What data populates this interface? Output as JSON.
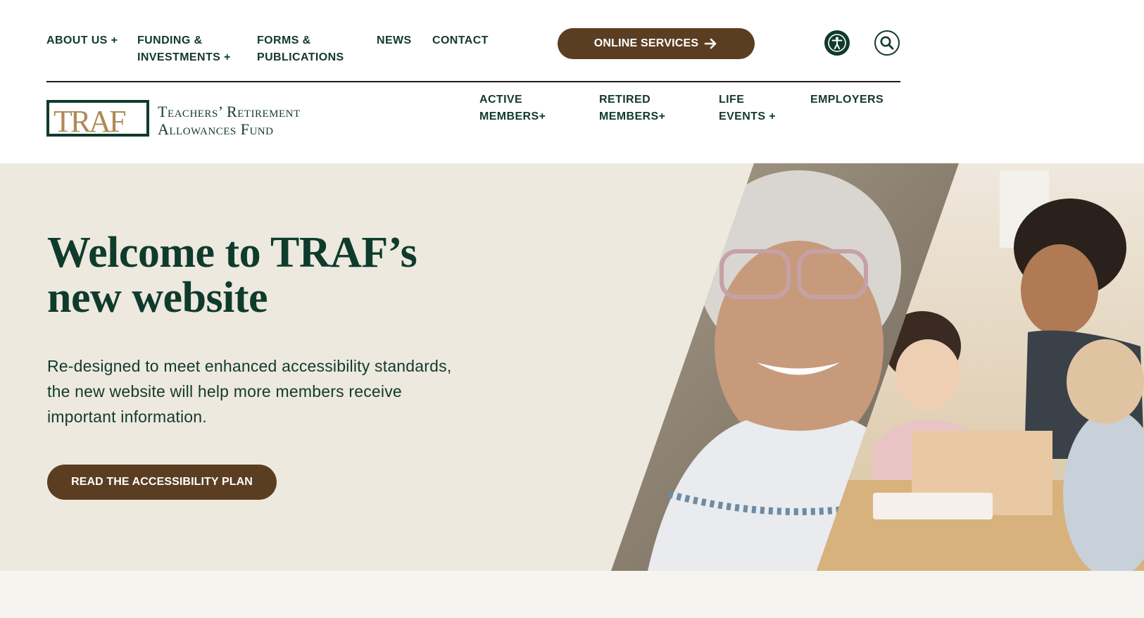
{
  "utility_nav": {
    "items": [
      {
        "line1": "ABOUT US +",
        "line2": ""
      },
      {
        "line1": "FUNDING &",
        "line2": "INVESTMENTS +"
      },
      {
        "line1": "FORMS &",
        "line2": "PUBLICATIONS"
      },
      {
        "line1": "NEWS",
        "line2": ""
      },
      {
        "line1": "CONTACT",
        "line2": ""
      }
    ],
    "online_services_label": "ONLINE SERVICES",
    "accessibility_icon": "accessibility-icon",
    "search_icon": "search-icon"
  },
  "logo": {
    "letters": "TRAF",
    "name_line1": "Teachers’ Retirement",
    "name_line2": "Allowances Fund"
  },
  "main_nav": {
    "items": [
      {
        "line1": "ACTIVE",
        "line2": "MEMBERS+"
      },
      {
        "line1": "RETIRED",
        "line2": "MEMBERS+"
      },
      {
        "line1": "LIFE",
        "line2": "EVENTS +"
      },
      {
        "line1": "EMPLOYERS",
        "line2": ""
      }
    ]
  },
  "hero": {
    "title": "Welcome to TRAF’s new website",
    "text": "Re-designed to meet enhanced accessibility standards, the new website will help more members receive important information.",
    "button_label": "READ THE ACCESSIBILITY PLAN"
  },
  "colors": {
    "brand_green": "#0f3b2c",
    "brand_brown": "#5b3e22",
    "logo_gold": "#b08a55",
    "hero_bg": "#ede9df"
  }
}
